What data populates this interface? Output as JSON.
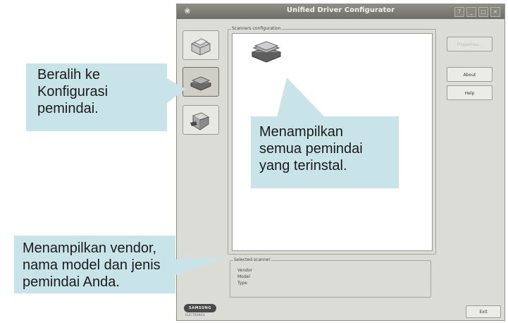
{
  "window": {
    "title": "Unified Driver Configurator",
    "controls": [
      "?",
      "_",
      "□",
      "×"
    ]
  },
  "nav": {
    "items": [
      {
        "name": "printer-configuration",
        "icon": "printer-icon",
        "active": false
      },
      {
        "name": "scanner-configuration",
        "icon": "scanner-icon",
        "active": true
      },
      {
        "name": "port-configuration",
        "icon": "port-icon",
        "active": false
      }
    ],
    "logo": "SAMSUNG",
    "logo_sub": "ELECTRONICS"
  },
  "scanner_config": {
    "group_label": "Scanners configuration",
    "items": [
      {
        "icon": "scanner-icon"
      }
    ]
  },
  "buttons": {
    "properties": "Properties...",
    "about": "About",
    "help": "Help",
    "exit": "Exit"
  },
  "selected_scanner": {
    "group_label": "Selected scanner",
    "vendor_label": "Vendor",
    "model_label": "Model",
    "type_label": "Type"
  },
  "callouts": {
    "switch": "Beralih ke\nKonfigurasi\npemindai.",
    "list": "Menampilkan\nsemua pemindai\nyang terinstal.",
    "details": "Menampilkan vendor,\nnama model dan jenis\npemindai Anda."
  },
  "colors": {
    "callout_bg": "#c9e4e9",
    "window_bg": "#dcdcd6",
    "titlebar": "#7e7e78"
  }
}
